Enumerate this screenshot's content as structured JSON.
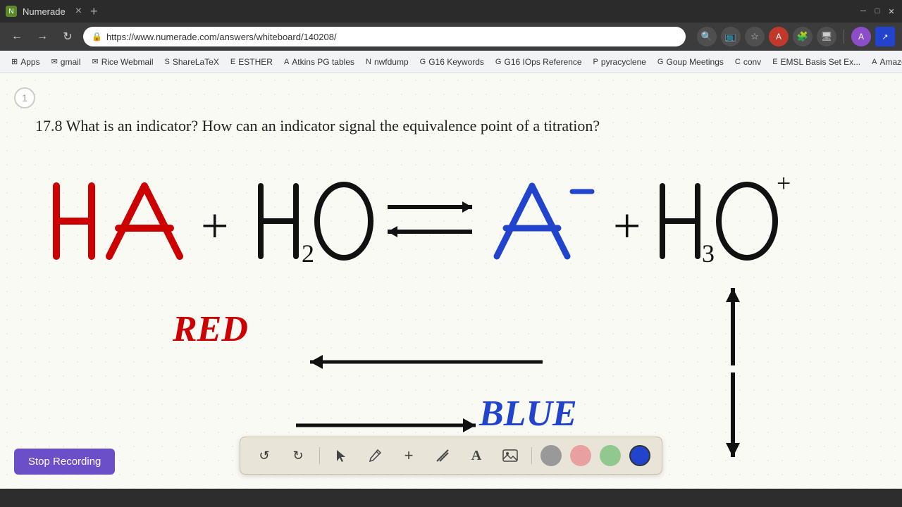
{
  "browser": {
    "title": "Numerade",
    "tab_close": "×",
    "new_tab": "+",
    "url": "https://www.numerade.com/answers/whiteboard/140208/",
    "nav_back": "←",
    "nav_forward": "→",
    "nav_refresh": "↻",
    "bookmarks": [
      {
        "label": "Apps",
        "icon": "⊞"
      },
      {
        "label": "gmail",
        "icon": "✉"
      },
      {
        "label": "Rice Webmail",
        "icon": "✉"
      },
      {
        "label": "ShareLaTeX",
        "icon": "S"
      },
      {
        "label": "ESTHER",
        "icon": "E"
      },
      {
        "label": "Atkins PG tables",
        "icon": "A"
      },
      {
        "label": "nwfdump",
        "icon": "N"
      },
      {
        "label": "G16 Keywords",
        "icon": "G"
      },
      {
        "label": "G16 IOps Reference",
        "icon": "G"
      },
      {
        "label": "pyracyclene",
        "icon": "P"
      },
      {
        "label": "Goup Meetings",
        "icon": "G"
      },
      {
        "label": "conv",
        "icon": "C"
      },
      {
        "label": "EMSL Basis Set Ex...",
        "icon": "E"
      },
      {
        "label": "Amazon",
        "icon": "A"
      }
    ],
    "bookmarks_more": "›"
  },
  "page": {
    "number": "1",
    "question": "17.8 What is an indicator? How can an indicator signal the equivalence point of a titration?"
  },
  "toolbar": {
    "undo_label": "↺",
    "redo_label": "↻",
    "select_label": "▲",
    "pen_label": "✏",
    "plus_label": "+",
    "eraser_label": "/",
    "text_label": "A",
    "image_label": "🖼",
    "colors": [
      {
        "name": "gray",
        "hex": "#999999"
      },
      {
        "name": "pink",
        "hex": "#e8a0a0"
      },
      {
        "name": "green",
        "hex": "#90c890"
      },
      {
        "name": "blue",
        "hex": "#2244cc"
      }
    ],
    "active_color": "blue"
  },
  "recording": {
    "button_label": "Stop Recording"
  }
}
